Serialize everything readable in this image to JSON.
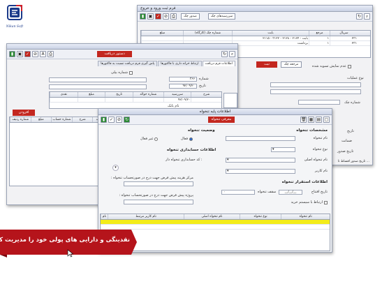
{
  "logo": {
    "caption": "Nikan Soft"
  },
  "back_window": {
    "title": "فرم ثبت ورود و خروج",
    "toolbar_buttons": [
      "save",
      "new",
      "delete",
      "print",
      "search",
      "refresh"
    ],
    "toolbar_text_1": "صدور چک",
    "toolbar_text_2": "سررسیدهای چک",
    "columns": [
      "سریال",
      "مرجع",
      "بابت",
      "شماره چک (کارگاه)",
      "مبلغ"
    ],
    "rows": [
      {
        "serial": "۲۳۱",
        "ref": "۱",
        "desc": "۲۱۱۵ - ۳۱۲۲ - ۲۱۲۸ - ۲۱۶۴ - بابت",
        "check": "",
        "amount": ""
      },
      {
        "serial": "۲۳۱",
        "ref": "۱",
        "desc": "برداشت",
        "check": "",
        "amount": ""
      }
    ],
    "red_button": "ثبت",
    "small_button": "مرجعه چک",
    "checkbox_label": "عدم نمایش تسویه شده",
    "side_labels": [
      "تاریخ",
      "نوع عملیات",
      "شماره چک",
      "تاریخ",
      "ضمانت",
      "تاریخ صدور"
    ],
    "footer": "تاریخ صدور اقساط تا ..."
  },
  "mid_window": {
    "title": "دستور دریافت",
    "tabs": [
      "اطلاعات فرم دریافت",
      "ارتباط خزانه داری با فاکتورها",
      "پاس گیری فرم دریافت نسبت به فاکتورها"
    ],
    "checkbox_label": "شماره بیلی",
    "labels": {
      "number": "شماره",
      "date": "تاریخ",
      "account": "حساب",
      "bank": "نام بانک"
    },
    "values": {
      "number": "۳۶۶",
      "date": "۹۲/۰۹/۲۰"
    },
    "table_headers": [
      "شرح",
      "سررسید",
      "شماره حواله",
      "تاریخ",
      "مبلغ",
      "نقدی"
    ],
    "table_value": "۹۲/۰۹/۲۰",
    "add_button": "افزودن",
    "lower_headers": [
      "ردیف",
      "شرح",
      "شماره حساب",
      "مبلغ",
      "شماره ردیف"
    ]
  },
  "front_window": {
    "title": "اطلاعات پایه تنخواه",
    "red_button": "معرفی تنخواه",
    "specs_title": "مشخصات تنخواه",
    "fields": {
      "name": "نام تنخواه",
      "type": "نوع تنخواه",
      "main_name": "نام تنخواه اصلی",
      "user": "نام کاربر"
    },
    "status_title": "وضعیت تنخواه",
    "status_active": "فعال",
    "status_inactive": "غیر فعال",
    "accounting_title": "اطلاعات حسابداری تنخواه",
    "accounting_has_account": "کد حسابداری تنخواه دار :",
    "cost_center": "مرکز هزینه پیش فرض جهت درج در صورتحساب تنخواه :",
    "project": "پروژه پیش فرض جهت درج در صورتحساب تنخواه :",
    "establish_title": "اطلاعات استقرار تنخواه",
    "open_date": "تاریخ افتتاح",
    "open_date_value": "__/__/__",
    "ceiling": "سقف تنخواه",
    "ceiling_value": "۰",
    "link_label": "ارتباط با سیستم خرید",
    "grid_headers": [
      "نام تنخواه",
      "نوع تنخواه",
      "نام تنخواه اصلی",
      "نام کاربر مرتبط",
      "نام"
    ]
  },
  "banner": {
    "text": "نقدینگی و دارایی های پولی خود را مدیریت کنید",
    "color": "#b5141b"
  }
}
